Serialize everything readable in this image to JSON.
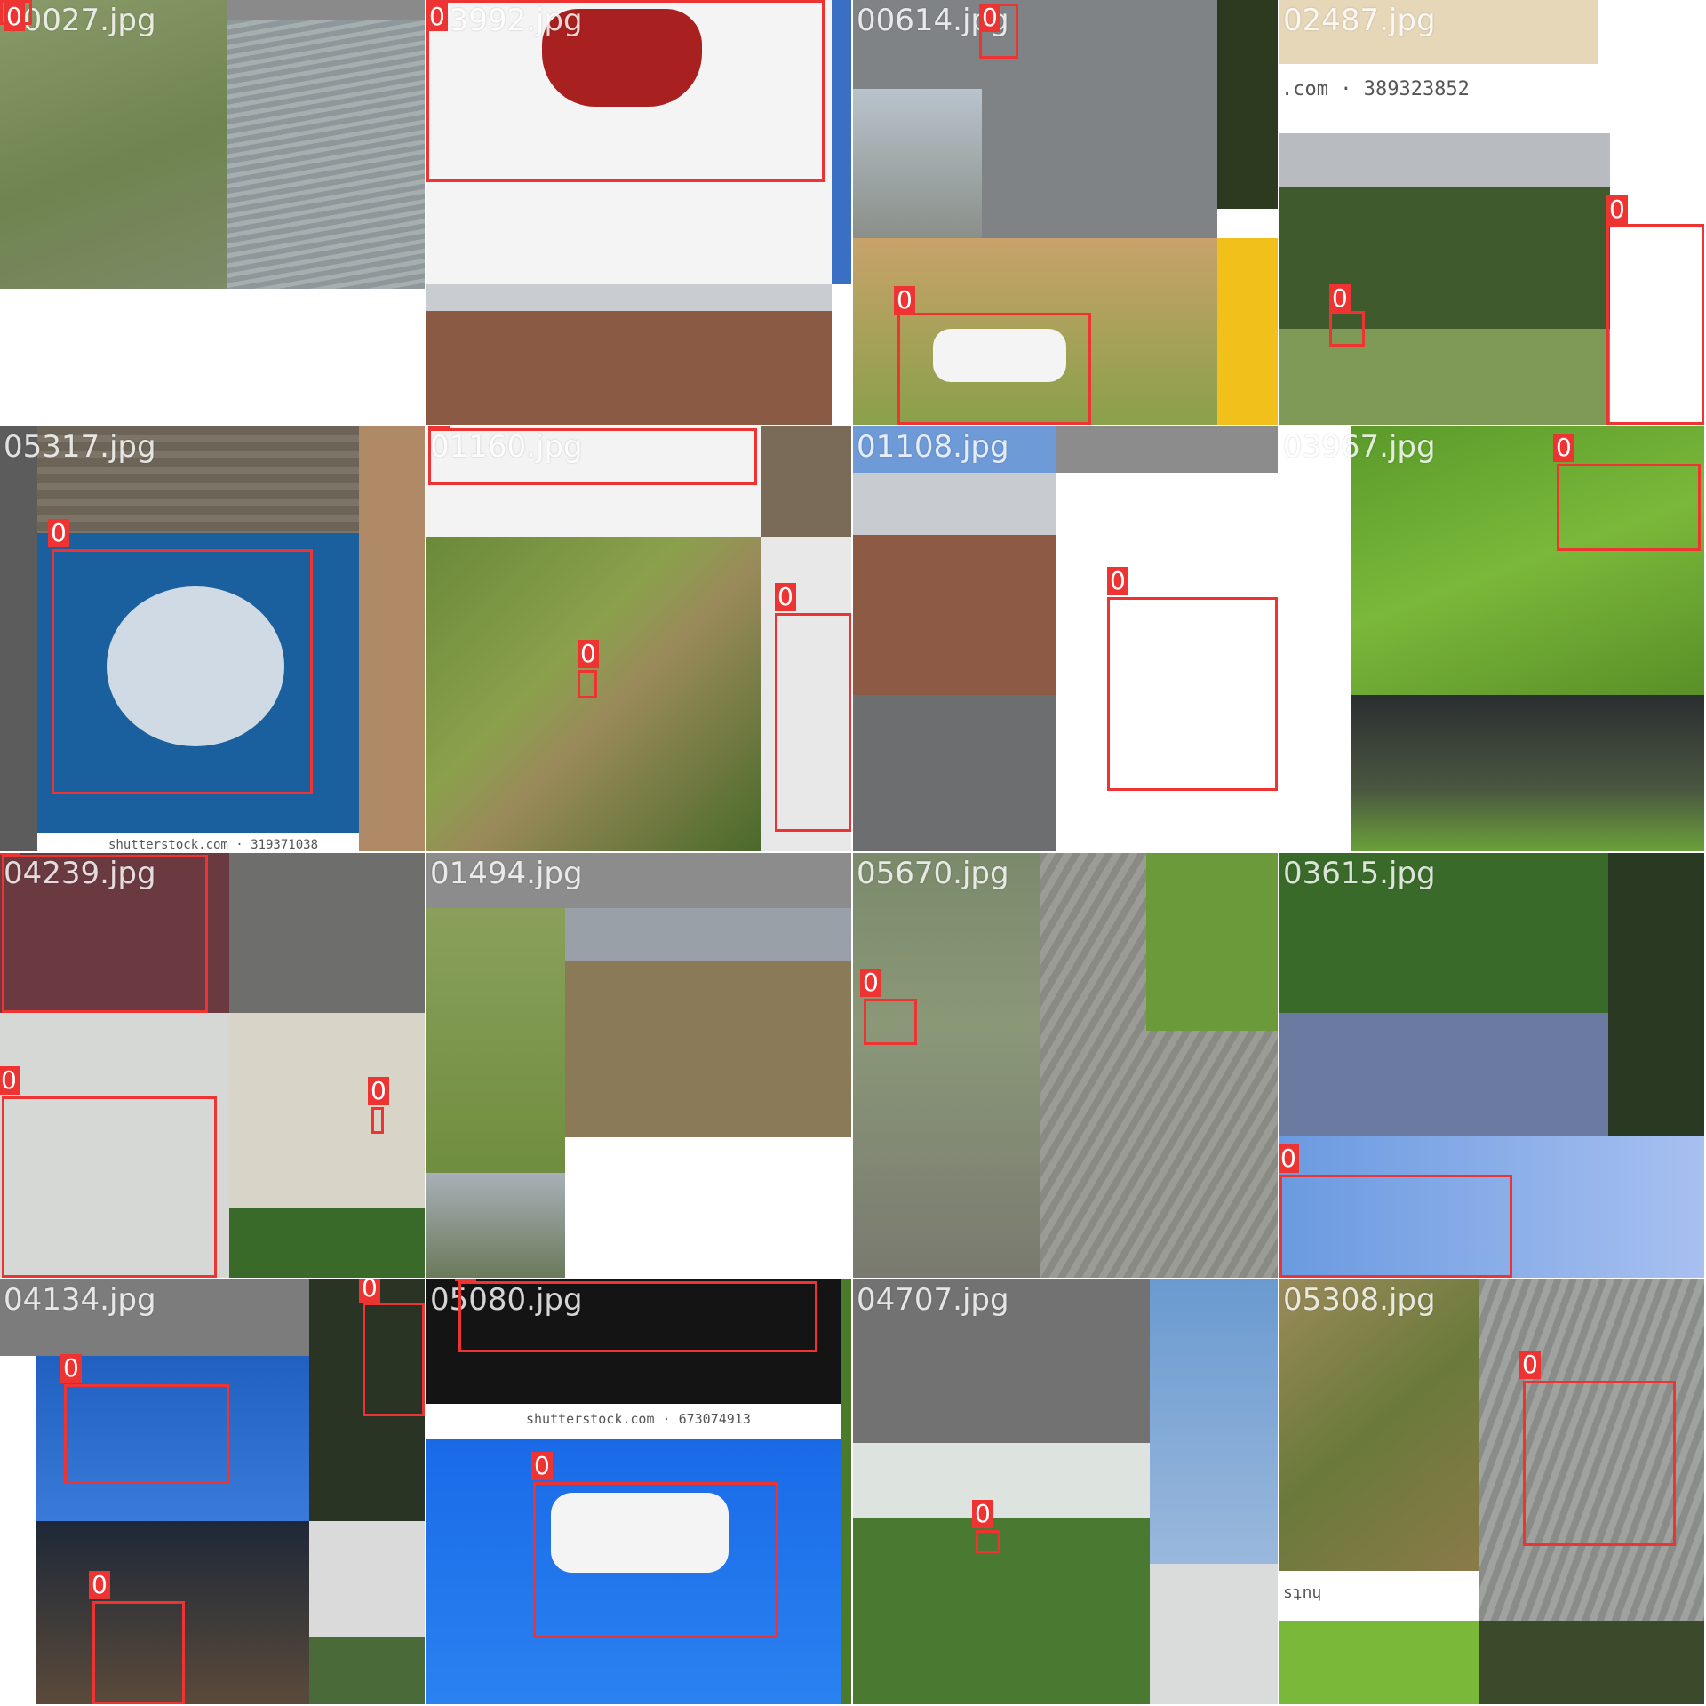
{
  "mosaic": {
    "class_label": "0",
    "box_color": "#ee3333",
    "tiles": [
      {
        "file": "00027.jpg",
        "boxes": 1
      },
      {
        "file": "03992.jpg",
        "boxes": 1
      },
      {
        "file": "00614.jpg",
        "boxes": 2
      },
      {
        "file": "02487.jpg",
        "boxes": 2,
        "watermark": ".com · 389323852"
      },
      {
        "file": "05317.jpg",
        "boxes": 1,
        "watermark": "shutterstock.com · 319371038"
      },
      {
        "file": "01160.jpg",
        "boxes": 3
      },
      {
        "file": "01108.jpg",
        "boxes": 1
      },
      {
        "file": "03967.jpg",
        "boxes": 1
      },
      {
        "file": "04239.jpg",
        "boxes": 3
      },
      {
        "file": "01494.jpg",
        "boxes": 0
      },
      {
        "file": "05670.jpg",
        "boxes": 1
      },
      {
        "file": "03615.jpg",
        "boxes": 1
      },
      {
        "file": "04134.jpg",
        "boxes": 3
      },
      {
        "file": "05080.jpg",
        "boxes": 2,
        "watermark": "shutterstock.com · 673074913"
      },
      {
        "file": "04707.jpg",
        "boxes": 1
      },
      {
        "file": "05308.jpg",
        "boxes": 1,
        "watermark": "sʇnɥ"
      }
    ]
  }
}
